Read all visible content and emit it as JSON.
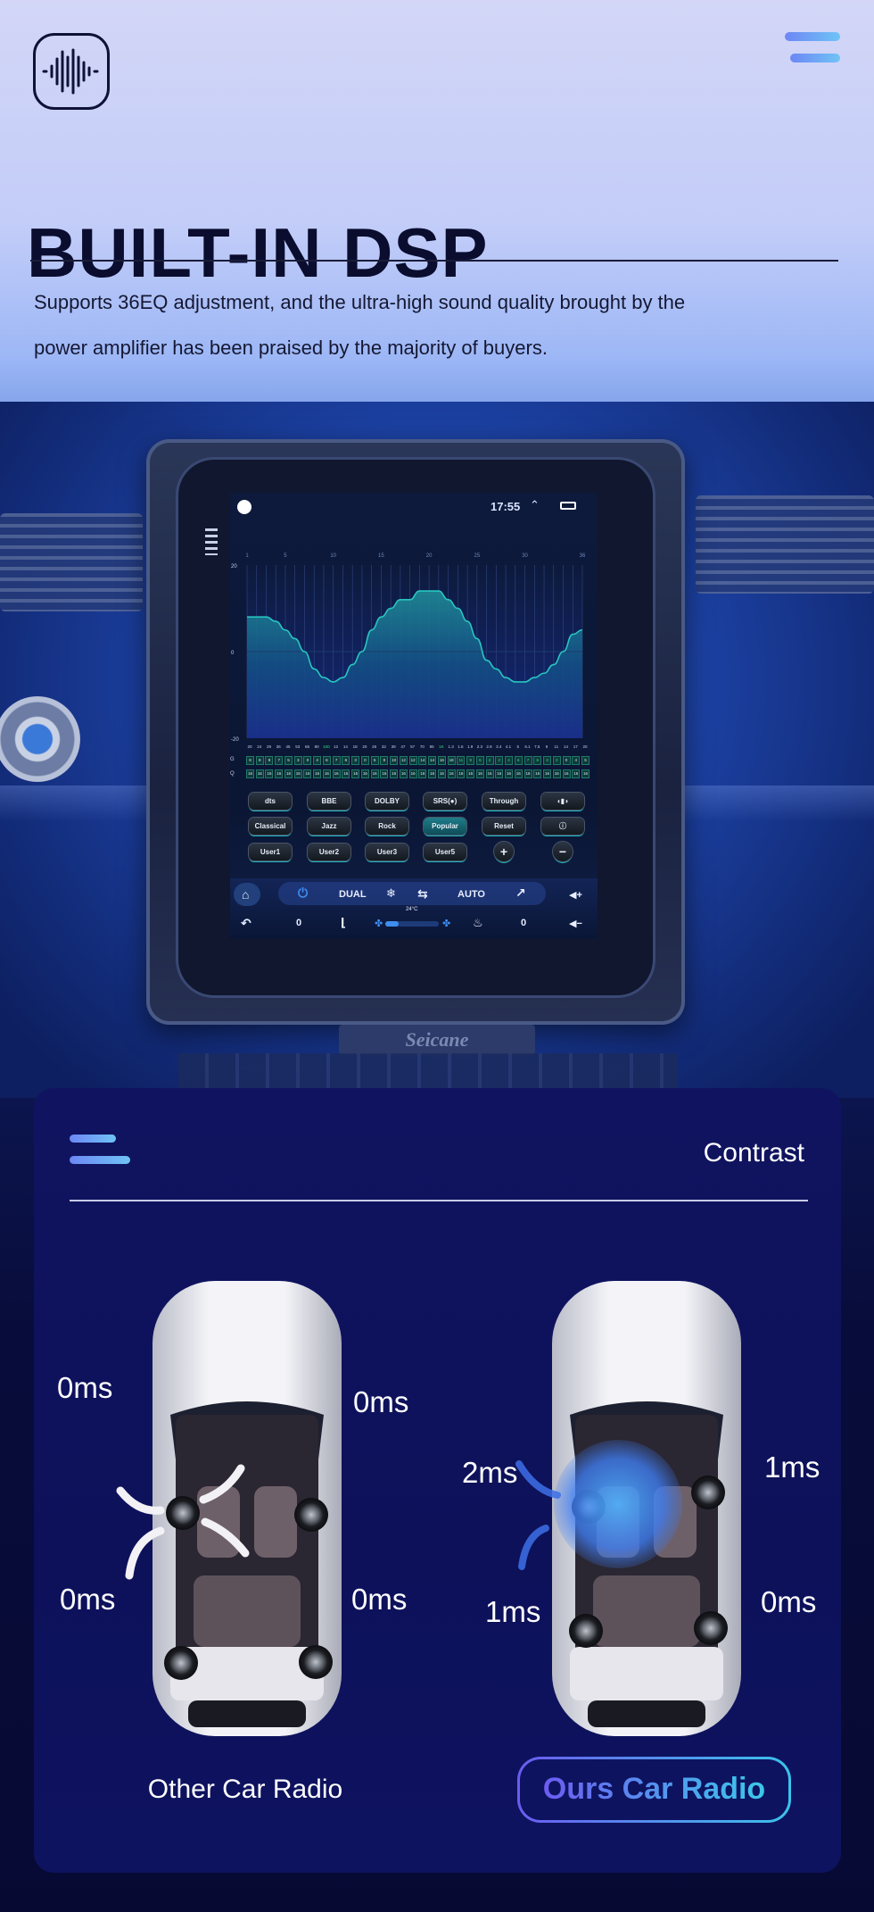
{
  "header": {
    "title": "BUILT-IN DSP",
    "description_line1": "Supports 36EQ adjustment, and the ultra-high sound quality brought by the",
    "description_line2": "power amplifier has been praised by the majority of buyers.",
    "logo_icon": "sound-wave-icon",
    "menu_icon": "menu-icon"
  },
  "radio": {
    "brand": "Seicane",
    "status": {
      "time": "17:55"
    },
    "eq": {
      "band_numbers": [
        "1",
        "5",
        "10",
        "15",
        "20",
        "25",
        "30",
        "36"
      ],
      "y_ticks": [
        "20",
        "0",
        "-20"
      ],
      "ylim": [
        -20,
        20
      ],
      "curve": [
        8,
        8,
        8,
        7,
        5,
        3,
        0,
        -4,
        -6,
        -7,
        -6,
        -3,
        0,
        5,
        8,
        10,
        12,
        12,
        14,
        14,
        14,
        12,
        10,
        7,
        3,
        -2,
        -4,
        -6,
        -7,
        -7,
        -6,
        -5,
        -3,
        0,
        4,
        5
      ],
      "freq_labels": [
        "20",
        "24",
        "29",
        "36",
        "45",
        "53",
        "65",
        "80",
        "100",
        "12",
        "14",
        "18",
        "20",
        "26",
        "32",
        "39",
        "47",
        "57",
        "70",
        "85",
        "1K",
        "1.3",
        "1.6",
        "1.9",
        "2.3",
        "2.8",
        "3.4",
        "4.1",
        "5",
        "6.1",
        "7.5",
        "9",
        "11",
        "14",
        "17",
        "20"
      ],
      "highlight_freqs": [
        8,
        20
      ],
      "g_label": "G",
      "q_label": "Q",
      "gains": [
        "8",
        "8",
        "8",
        "7",
        "5",
        "3",
        "0",
        "4",
        "6",
        "7",
        "6",
        "3",
        "0",
        "5",
        "8",
        "10",
        "12",
        "12",
        "14",
        "14",
        "16",
        "18",
        "11",
        "9",
        "6",
        "2",
        "2",
        "4",
        "6",
        "7",
        "6",
        "3",
        "2",
        "0",
        "4",
        "5"
      ],
      "q_value": "16",
      "accent": "#27c6c0"
    },
    "buttons": [
      [
        "dts",
        "BBE",
        "DOLBY",
        "SRS(●)",
        "Through",
        "◖▮◗"
      ],
      [
        "Classical",
        "Jazz",
        "Rock",
        "Popular",
        "Reset",
        "ⓘ"
      ],
      [
        "User1",
        "User2",
        "User3",
        "User5",
        "+",
        "−"
      ]
    ],
    "active_preset": "Popular",
    "climate": {
      "dual": "DUAL",
      "auto": "AUTO",
      "temp": "24°C",
      "left_value": "0",
      "right_value": "0",
      "fan_level": 0.25,
      "icons": {
        "home": "⌂",
        "power": "⏻",
        "snow": "❄",
        "recirc": "⇆",
        "airflow": "↗",
        "vol_up": "◀+",
        "back": "↶",
        "seat": "⌊",
        "fan": "✤",
        "seat_heat": "♨",
        "vol_down": "◀−"
      }
    }
  },
  "contrast": {
    "title": "Contrast",
    "other": {
      "label": "Other Car Radio",
      "delays": [
        "0ms",
        "0ms",
        "0ms",
        "0ms"
      ]
    },
    "ours": {
      "label": "Ours Car Radio",
      "delays": [
        "2ms",
        "1ms",
        "1ms",
        "0ms"
      ]
    }
  }
}
